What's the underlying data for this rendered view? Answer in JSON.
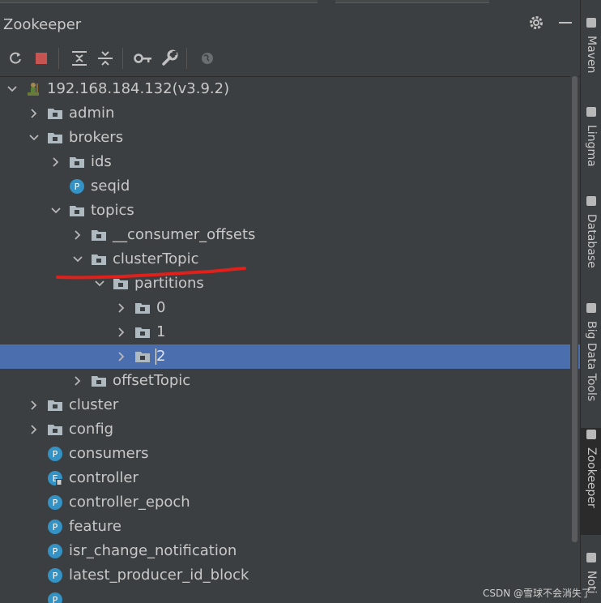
{
  "panel": {
    "title": "Zookeeper"
  },
  "toolbar": {
    "icons": [
      "refresh-icon",
      "stop-icon",
      "expand-all-icon",
      "collapse-all-icon",
      "key-icon",
      "wrench-icon",
      "globe-icon"
    ]
  },
  "tree": {
    "rows": [
      {
        "label": "192.168.184.132(v3.9.2)",
        "depth": 0,
        "chevron": "down",
        "icon": "server"
      },
      {
        "label": "admin",
        "depth": 1,
        "chevron": "right",
        "icon": "folder"
      },
      {
        "label": "brokers",
        "depth": 1,
        "chevron": "down",
        "icon": "folder"
      },
      {
        "label": "ids",
        "depth": 2,
        "chevron": "right",
        "icon": "folder"
      },
      {
        "label": "seqid",
        "depth": 2,
        "chevron": "none",
        "icon": "p"
      },
      {
        "label": "topics",
        "depth": 2,
        "chevron": "down",
        "icon": "folder"
      },
      {
        "label": "__consumer_offsets",
        "depth": 3,
        "chevron": "right",
        "icon": "folder"
      },
      {
        "label": "clusterTopic",
        "depth": 3,
        "chevron": "down",
        "icon": "folder"
      },
      {
        "label": "partitions",
        "depth": 4,
        "chevron": "down",
        "icon": "folder"
      },
      {
        "label": "0",
        "depth": 5,
        "chevron": "right",
        "icon": "folder"
      },
      {
        "label": "1",
        "depth": 5,
        "chevron": "right",
        "icon": "folder"
      },
      {
        "label": "2",
        "depth": 5,
        "chevron": "right",
        "icon": "folder",
        "selected": true
      },
      {
        "label": "offsetTopic",
        "depth": 3,
        "chevron": "right",
        "icon": "folder"
      },
      {
        "label": "cluster",
        "depth": 1,
        "chevron": "right",
        "icon": "folder"
      },
      {
        "label": "config",
        "depth": 1,
        "chevron": "right",
        "icon": "folder"
      },
      {
        "label": "consumers",
        "depth": 1,
        "chevron": "none",
        "icon": "p"
      },
      {
        "label": "controller",
        "depth": 1,
        "chevron": "none",
        "icon": "e"
      },
      {
        "label": "controller_epoch",
        "depth": 1,
        "chevron": "none",
        "icon": "p"
      },
      {
        "label": "feature",
        "depth": 1,
        "chevron": "none",
        "icon": "p"
      },
      {
        "label": "isr_change_notification",
        "depth": 1,
        "chevron": "none",
        "icon": "p"
      },
      {
        "label": "latest_producer_id_block",
        "depth": 1,
        "chevron": "none",
        "icon": "p"
      },
      {
        "label": "",
        "depth": 1,
        "chevron": "none",
        "icon": "p"
      }
    ]
  },
  "right_tools": [
    {
      "label": "Maven",
      "icon": "maven-icon"
    },
    {
      "label": "Lingma",
      "icon": "lingma-icon"
    },
    {
      "label": "Database",
      "icon": "database-icon"
    },
    {
      "label": "Big Data Tools",
      "icon": "big-data-tools-icon"
    },
    {
      "label": "Zookeeper",
      "icon": "zookeeper-icon",
      "active": true
    },
    {
      "label": "Noti",
      "icon": "notifications-icon"
    }
  ],
  "watermark": "CSDN @雪球不会消失了",
  "colors": {
    "panel_bg": "#3c3f41",
    "selection": "#4b6eaf",
    "folder": "#aeb9c0",
    "p_badge": "#3592c4",
    "annotation": "#e0201b"
  }
}
